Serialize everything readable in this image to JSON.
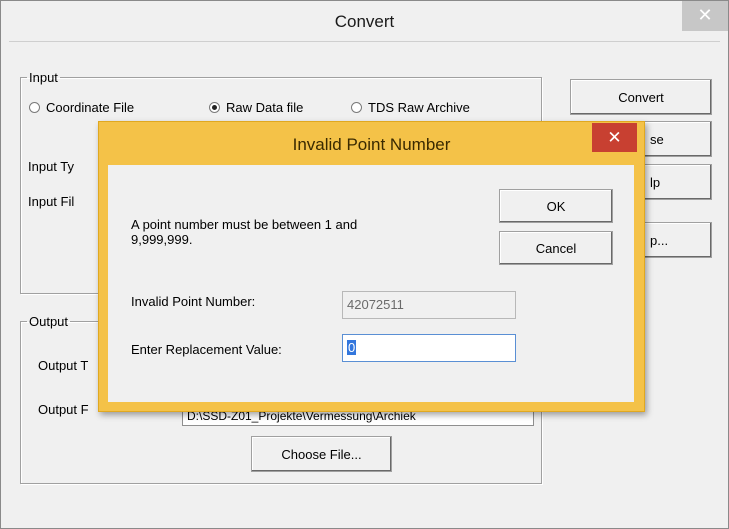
{
  "main_window": {
    "title": "Convert",
    "close_glyph": "✕",
    "input_group": {
      "legend": "Input",
      "radios": [
        {
          "label": "Coordinate File",
          "checked": false
        },
        {
          "label": "Raw Data file",
          "checked": true
        },
        {
          "label": "TDS Raw Archive",
          "checked": false
        }
      ],
      "input_type_label": "Input Ty",
      "input_file_label": "Input Fil"
    },
    "buttons": {
      "convert": "Convert",
      "close_partial": "se",
      "help_partial": "lp",
      "setup_partial": "p..."
    },
    "output_group": {
      "legend": "Output",
      "output_type_label": "Output T",
      "output_file_label": "Output F",
      "output_file_value": "D:\\SSD-Z01_Projekte\\Vermessung\\Archiek",
      "choose_file_button": "Choose File..."
    }
  },
  "dialog": {
    "title": "Invalid Point Number",
    "close_glyph": "✕",
    "message_line1": "A point number must be between 1 and",
    "message_line2": "9,999,999.",
    "ok_button": "OK",
    "cancel_button": "Cancel",
    "invalid_label": "Invalid Point Number:",
    "invalid_value": "42072511",
    "replacement_label": "Enter Replacement Value:",
    "replacement_value": "0"
  }
}
